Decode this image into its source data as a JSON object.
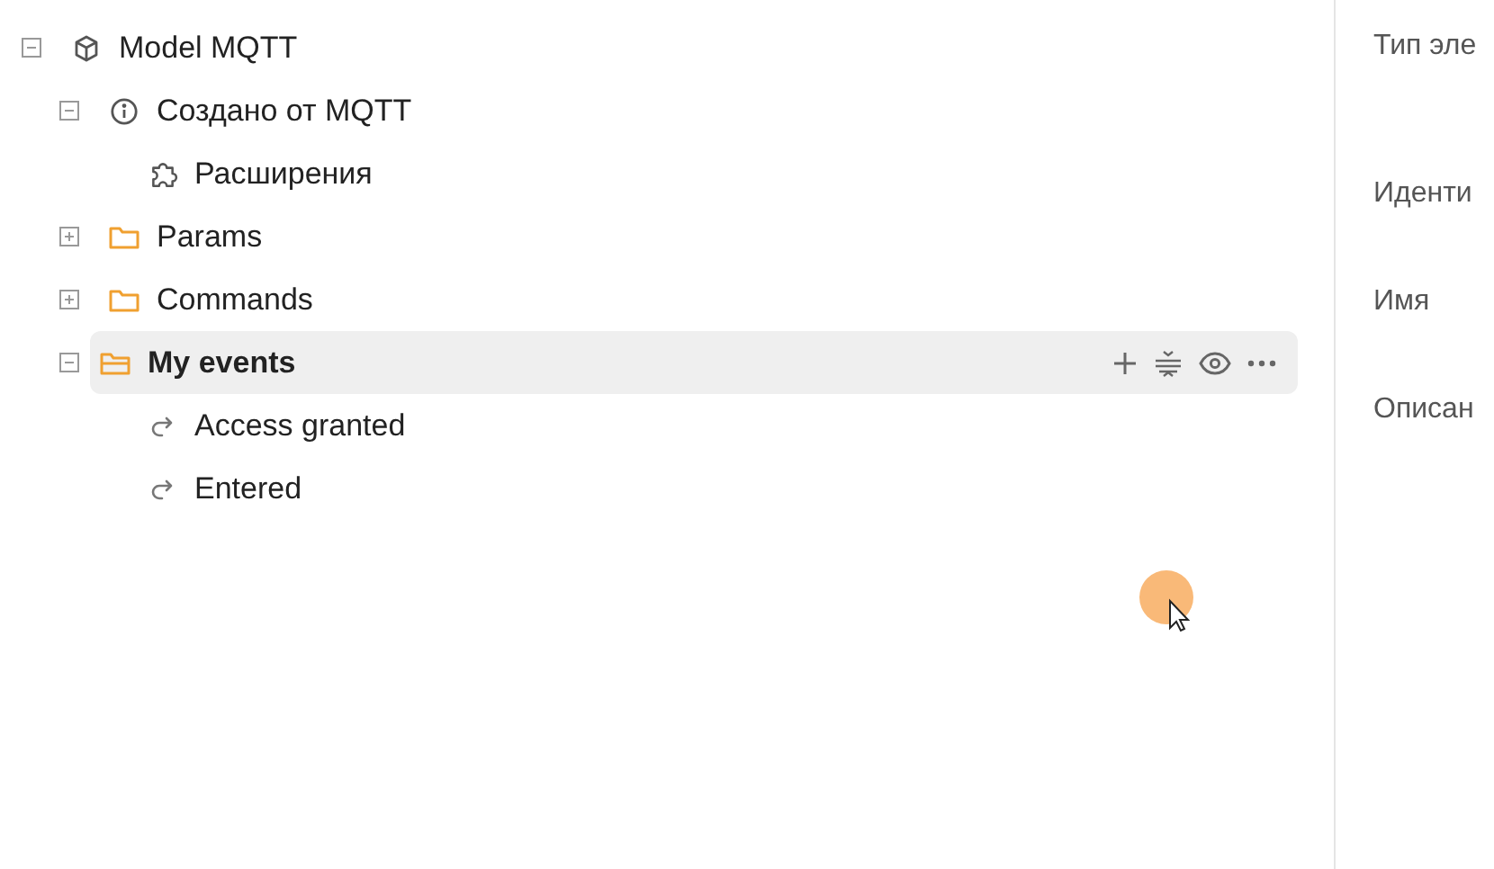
{
  "tree": [
    {
      "label": "Model MQTT",
      "kind": "model",
      "expanded": true,
      "selected": false,
      "children": [
        {
          "label": "Создано от MQTT",
          "kind": "info",
          "expanded": true,
          "selected": false,
          "children": [
            {
              "label": "Расширения",
              "kind": "extension",
              "selected": false
            }
          ]
        },
        {
          "label": "Params",
          "kind": "folder",
          "expanded": false,
          "selected": false
        },
        {
          "label": "Commands",
          "kind": "folder",
          "expanded": false,
          "selected": false
        },
        {
          "label": "My events",
          "kind": "folder",
          "expanded": true,
          "selected": true,
          "children": [
            {
              "label": "Access granted",
              "kind": "event",
              "selected": false
            },
            {
              "label": "Entered",
              "kind": "event",
              "selected": false
            }
          ]
        }
      ]
    }
  ],
  "properties": [
    {
      "label": "Тип эле"
    },
    {
      "label": "Иденти"
    },
    {
      "label": "Имя"
    },
    {
      "label": "Описан"
    }
  ]
}
